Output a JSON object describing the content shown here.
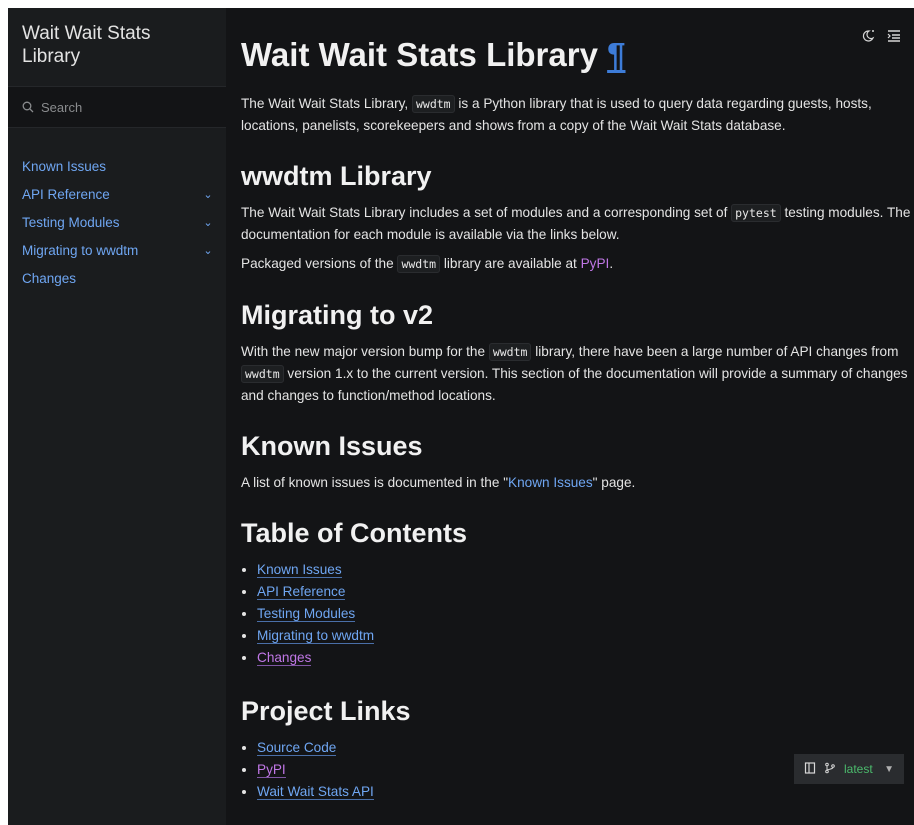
{
  "sidebar": {
    "brand": "Wait Wait Stats Library",
    "search_placeholder": "Search",
    "items": [
      {
        "label": "Known Issues",
        "expandable": false
      },
      {
        "label": "API Reference",
        "expandable": true
      },
      {
        "label": "Testing Modules",
        "expandable": true
      },
      {
        "label": "Migrating to wwdtm",
        "expandable": true
      },
      {
        "label": "Changes",
        "expandable": false
      }
    ]
  },
  "header": {
    "theme_icon": "theme-toggle-icon",
    "toc_icon": "toc-icon"
  },
  "main": {
    "title": "Wait Wait Stats Library",
    "pilcrow": "¶",
    "intro_a": "The Wait Wait Stats Library,",
    "intro_code": "wwdtm",
    "intro_b": "is a Python library that is used to query data regarding guests, hosts, locations, panelists, scorekeepers and shows from a copy of the Wait Wait Stats database.",
    "lib_heading": "wwdtm Library",
    "lib_p1_a": "The Wait Wait Stats Library includes a set of modules and a corresponding set of",
    "lib_p1_code": "pytest",
    "lib_p1_b": "testing modules. The documentation for each module is available via the links below.",
    "lib_p2_a": "Packaged versions of the",
    "lib_p2_code": "wwdtm",
    "lib_p2_b": "library are available at",
    "lib_p2_link": "PyPI",
    "lib_p2_c": ".",
    "mig_heading": "Migrating to v2",
    "mig_a": "With the new major version bump for the",
    "mig_code1": "wwdtm",
    "mig_b": "library, there have been a large number of API changes from",
    "mig_code2": "wwdtm",
    "mig_c": "version 1.x to the current version. This section of the documentation will provide a summary of changes and changes to function/method locations.",
    "known_heading": "Known Issues",
    "known_a": "A list of known issues is documented in the \"",
    "known_link": "Known Issues",
    "known_b": "\" page.",
    "toc_heading": "Table of Contents",
    "toc": [
      "Known Issues",
      "API Reference",
      "Testing Modules",
      "Migrating to wwdtm",
      "Changes"
    ],
    "links_heading": "Project Links",
    "links": [
      "Source Code",
      "PyPI",
      "Wait Wait Stats API"
    ]
  },
  "version_badge": {
    "label": "latest"
  },
  "colors": {
    "link": "#6fa6f2",
    "visited": "#c077e6",
    "sidebar_bg": "#1a1c1e",
    "main_bg": "#131416",
    "version": "#4bba6c"
  }
}
